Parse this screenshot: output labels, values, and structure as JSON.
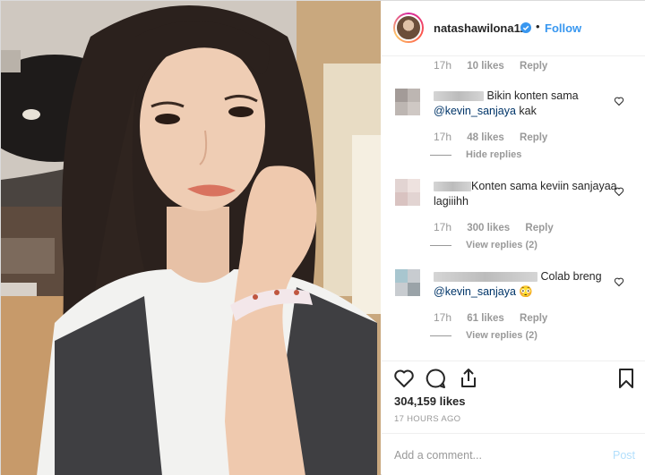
{
  "header": {
    "username": "natashawilona12",
    "separator": "•",
    "follow_label": "Follow"
  },
  "comments": {
    "top_meta": {
      "time": "17h",
      "likes": "10 likes",
      "reply": "Reply"
    },
    "items": [
      {
        "text": "Bikin konten sama",
        "mention": "@kevin_sanjaya",
        "text_after": " kak",
        "time": "17h",
        "likes": "48 likes",
        "reply": "Reply",
        "replies_link": "Hide replies"
      },
      {
        "text": "Konten sama keviin sanjayaa lagiiihh",
        "time": "17h",
        "likes": "300 likes",
        "reply": "Reply",
        "replies_link": "View replies (2)"
      },
      {
        "text": "Colab breng",
        "mention": "@kevin_sanjaya",
        "emoji": "😳",
        "time": "17h",
        "likes": "61 likes",
        "reply": "Reply",
        "replies_link": "View replies (2)"
      }
    ]
  },
  "post": {
    "likes": "304,159 likes",
    "timestamp": "17 HOURS AGO"
  },
  "add_comment": {
    "placeholder": "Add a comment...",
    "post_label": "Post"
  },
  "icons": {
    "verified": "verified-badge-icon",
    "like": "heart-icon",
    "comment": "comment-icon",
    "share": "share-icon",
    "save": "bookmark-icon"
  },
  "colors": {
    "link_blue": "#3897f0",
    "mention_blue": "#003569",
    "muted": "#999999",
    "post_disabled": "#b2dffc"
  }
}
